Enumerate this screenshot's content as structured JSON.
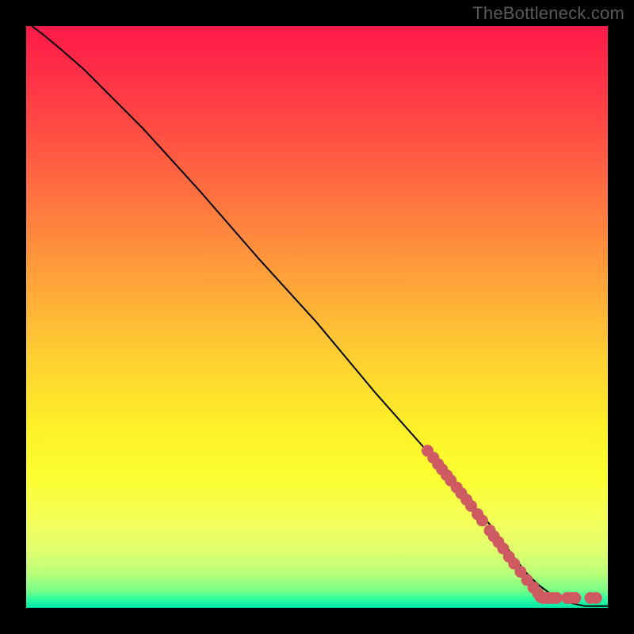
{
  "watermark": "TheBottleneck.com",
  "chart_data": {
    "type": "line",
    "title": "",
    "xlabel": "",
    "ylabel": "",
    "xlim": [
      0,
      1
    ],
    "ylim": [
      0,
      1
    ],
    "curve": {
      "name": "bottleneck-curve",
      "x": [
        0.01,
        0.03,
        0.06,
        0.1,
        0.15,
        0.2,
        0.3,
        0.4,
        0.5,
        0.6,
        0.68,
        0.74,
        0.8,
        0.84,
        0.86,
        0.88,
        0.9,
        0.93,
        0.96,
        1.0
      ],
      "y": [
        1.0,
        0.985,
        0.96,
        0.925,
        0.875,
        0.825,
        0.715,
        0.6,
        0.49,
        0.37,
        0.28,
        0.21,
        0.14,
        0.085,
        0.06,
        0.04,
        0.025,
        0.01,
        0.003,
        0.003
      ]
    },
    "markers": {
      "name": "dense-region-points",
      "color": "#cf5b62",
      "points": [
        {
          "x": 0.69,
          "y": 0.27
        },
        {
          "x": 0.7,
          "y": 0.258
        },
        {
          "x": 0.708,
          "y": 0.247
        },
        {
          "x": 0.715,
          "y": 0.238
        },
        {
          "x": 0.723,
          "y": 0.228
        },
        {
          "x": 0.73,
          "y": 0.219
        },
        {
          "x": 0.74,
          "y": 0.207
        },
        {
          "x": 0.748,
          "y": 0.197
        },
        {
          "x": 0.757,
          "y": 0.186
        },
        {
          "x": 0.765,
          "y": 0.175
        },
        {
          "x": 0.776,
          "y": 0.161
        },
        {
          "x": 0.784,
          "y": 0.15
        },
        {
          "x": 0.797,
          "y": 0.133
        },
        {
          "x": 0.804,
          "y": 0.123
        },
        {
          "x": 0.812,
          "y": 0.113
        },
        {
          "x": 0.82,
          "y": 0.102
        },
        {
          "x": 0.83,
          "y": 0.088
        },
        {
          "x": 0.839,
          "y": 0.076
        },
        {
          "x": 0.85,
          "y": 0.062
        },
        {
          "x": 0.861,
          "y": 0.048
        },
        {
          "x": 0.872,
          "y": 0.035
        },
        {
          "x": 0.88,
          "y": 0.025
        },
        {
          "x": 0.884,
          "y": 0.019
        },
        {
          "x": 0.888,
          "y": 0.017
        },
        {
          "x": 0.893,
          "y": 0.017
        },
        {
          "x": 0.898,
          "y": 0.017
        },
        {
          "x": 0.905,
          "y": 0.017
        },
        {
          "x": 0.912,
          "y": 0.017
        },
        {
          "x": 0.93,
          "y": 0.017
        },
        {
          "x": 0.937,
          "y": 0.017
        },
        {
          "x": 0.944,
          "y": 0.017
        },
        {
          "x": 0.97,
          "y": 0.017
        },
        {
          "x": 0.98,
          "y": 0.017
        }
      ]
    },
    "gradient_stops": [
      {
        "pos": 0.0,
        "color": "#ff1a48"
      },
      {
        "pos": 0.5,
        "color": "#ffd032"
      },
      {
        "pos": 0.8,
        "color": "#fbff33"
      },
      {
        "pos": 1.0,
        "color": "#00e6a8"
      }
    ]
  }
}
